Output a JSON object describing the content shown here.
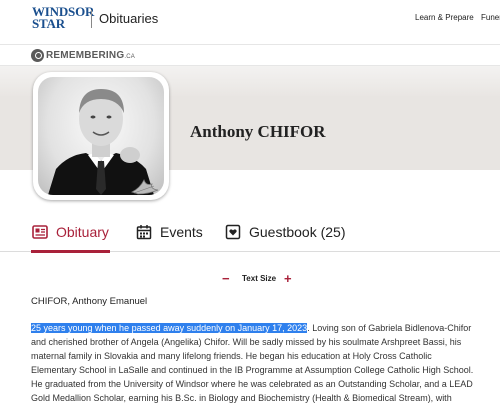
{
  "header": {
    "logo_line1": "WINDSOR",
    "logo_line2": "STAR",
    "section": "Obituaries",
    "nav": [
      "Learn & Prepare",
      "Funera"
    ]
  },
  "remembering": {
    "brand": "REMEMBERING",
    "suffix": ".CA"
  },
  "person": {
    "name": "Anthony CHIFOR"
  },
  "tabs": [
    {
      "label": "Obituary",
      "icon": "obituary-icon",
      "active": true
    },
    {
      "label": "Events",
      "icon": "calendar-icon",
      "active": false
    },
    {
      "label": "Guestbook (25)",
      "icon": "guestbook-icon",
      "active": false
    }
  ],
  "text_size": {
    "label": "Text Size",
    "minus": "−",
    "plus": "+"
  },
  "obituary": {
    "full_name": "CHIFOR, Anthony Emanuel",
    "highlighted": "25 years young when he passed away suddenly on January 17, 2023",
    "rest_first_line": ". Loving son of Gabriela Bidlenova-Chifor",
    "lines": [
      "and cherished brother of Angela (Angelika) Chifor. Will be sadly missed by his soulmate Arshpreet Bassi, his",
      "maternal family in Slovakia and many lifelong friends. He began his education at Holy Cross Catholic",
      "Elementary School in LaSalle and continued in the IB Programme at Assumption College Catholic High School.",
      "He graduated from the University of Windsor where he was celebrated as an Outstanding Scholar, and a LEAD",
      "Gold Medallion Scholar, earning his B.Sc. in Biology and Biochemistry (Health & Biomedical Stream), with"
    ]
  },
  "colors": {
    "accent": "#a9213a",
    "logo": "#1a4f8e",
    "highlight": "#2f80ed"
  }
}
